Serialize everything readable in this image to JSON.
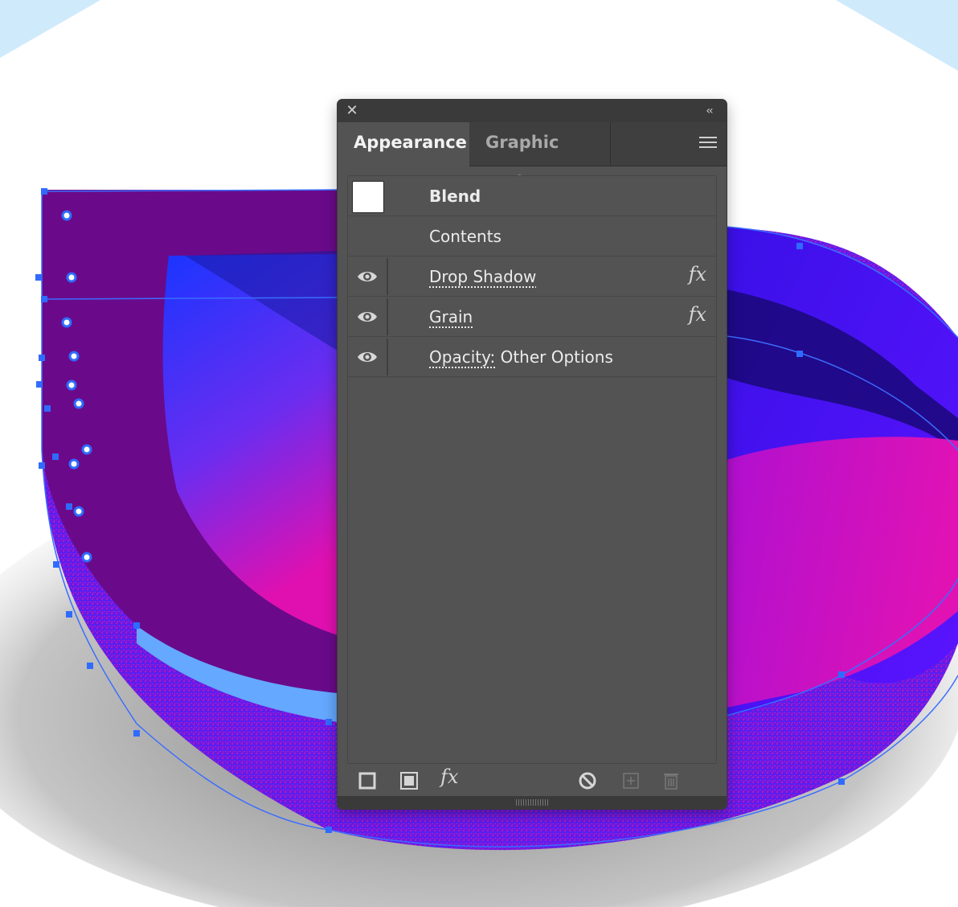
{
  "panel": {
    "tabs": [
      {
        "label": "Appearance",
        "active": true
      },
      {
        "label": "Graphic Styles",
        "active": false
      }
    ],
    "rows": [
      {
        "label": "Blend",
        "kind": "object",
        "swatch_color": "#ffffff"
      },
      {
        "label": "Contents",
        "kind": "contents"
      },
      {
        "label": "Drop Shadow",
        "kind": "effect",
        "visible": true,
        "fx": "fx"
      },
      {
        "label": "Grain",
        "kind": "effect",
        "visible": true,
        "fx": "fx"
      },
      {
        "label": "Opacity:",
        "suffix": "Other Options",
        "kind": "opacity",
        "visible": true
      }
    ],
    "bottom_icons": [
      "add-new-stroke-icon",
      "add-new-fill-icon",
      "add-new-effect-icon",
      "clear-appearance-icon",
      "duplicate-item-icon",
      "delete-item-icon"
    ],
    "fx_menu_label": "fx"
  },
  "colors": {
    "panel_bg": "#535353",
    "titlebar_bg": "#3a3a3a",
    "artwork_purple": "#6a0a8a",
    "artwork_blue": "#1f3cff",
    "artwork_magenta": "#e010b0",
    "anchor_blue": "#2f6bff"
  }
}
